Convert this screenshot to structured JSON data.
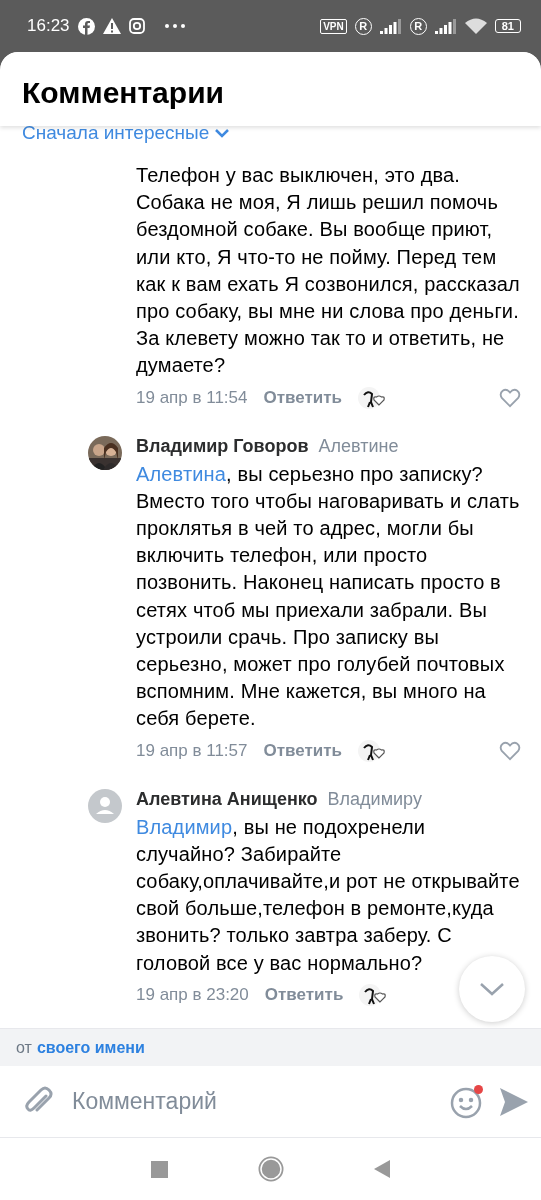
{
  "status_bar": {
    "time": "16:23",
    "vpn": "VPN",
    "roaming": [
      "R",
      "R"
    ],
    "battery": "81"
  },
  "header": {
    "title": "Комментарии"
  },
  "sort": {
    "label": "Сначала интересные"
  },
  "comments": [
    {
      "kind": "continuation",
      "text": "Телефон у вас выключен, это два. Собака не моя, Я лишь решил помочь бездомной собаке. Вы вообще приют, или кто, Я что-то не пойму. Перед тем как к вам ехать Я созвонился, рассказал про собаку, вы мне ни слова про деньги. За клевету можно так то и ответить, не думаете?",
      "date": "19 апр в 11:54",
      "reply": "Ответить",
      "like_button": true
    },
    {
      "author": "Владимир Говоров",
      "reply_to": "Алевтине",
      "mention": "Алевтина",
      "text": ", вы серьезно про записку? Вместо того чтобы наговаривать и слать проклятья в чей то адрес, могли бы включить телефон, или просто позвонить. Наконец написать просто в сетях чтоб мы приехали забрали. Вы устроили срачь. Про записку вы серьезно, может про голубей почтовых вспомним. Мне кажется, вы много на себя берете.",
      "date": "19 апр в 11:57",
      "reply": "Ответить",
      "like_button": true
    },
    {
      "author": "Алевтина Анищенко",
      "reply_to": "Владимиру",
      "mention": "Владимир",
      "kind": "placeholder",
      "text": ", вы не подохренели случайно? Забирайте собаку,оплачивайте,и рот не открывайте свой больше,телефон в ремонте,куда звонить? только завтра заберу. С головой все у вас нормально?",
      "date": "19 апр в 23:20",
      "reply": "Ответить",
      "like_button": false
    }
  ],
  "sender": {
    "prefix": "от",
    "name": "своего имени"
  },
  "composer": {
    "placeholder": "Комментарий",
    "emoji_badge": true
  }
}
